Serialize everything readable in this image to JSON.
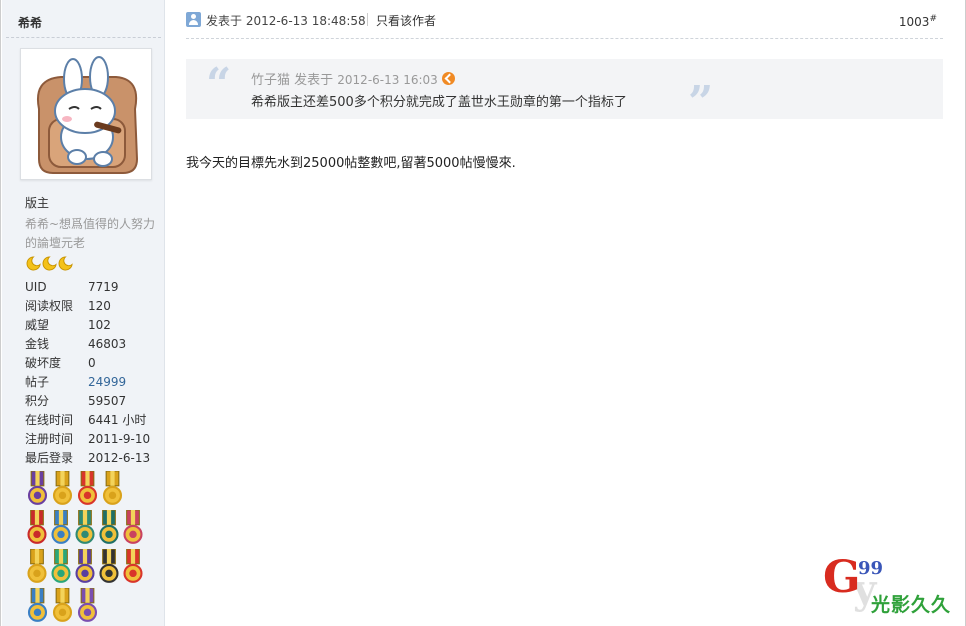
{
  "user": {
    "name": "希希",
    "role": "版主",
    "signature": "希希~想爲值得的人努力的論壇元老",
    "stats": [
      {
        "key": "UID",
        "value": "7719",
        "link": false
      },
      {
        "key": "阅读权限",
        "value": "120",
        "link": false
      },
      {
        "key": "威望",
        "value": "102",
        "link": false
      },
      {
        "key": "金钱",
        "value": "46803",
        "link": false
      },
      {
        "key": "破坏度",
        "value": "0",
        "link": false
      },
      {
        "key": "帖子",
        "value": "24999",
        "link": true
      },
      {
        "key": "积分",
        "value": "59507",
        "link": false
      },
      {
        "key": "在线时间",
        "value": "6441 小时",
        "link": false
      },
      {
        "key": "注册时间",
        "value": "2011-9-10",
        "link": false
      },
      {
        "key": "最后登录",
        "value": "2012-6-13",
        "link": false
      }
    ],
    "avatar_icon": "cartoon-rabbit-in-armchair",
    "star_icon": "crescent-moon-icon",
    "star_count": 3
  },
  "post": {
    "time": "发表于 2012-6-13 18:48:58",
    "only_author": "只看该作者",
    "floor": "1003",
    "floor_mark": "#",
    "quote": {
      "author": "竹子猫 发表于",
      "time": "2012-6-13 16:03",
      "text": "希希版主还差500多个积分就完成了盖世水王勋章的第一个指标了"
    },
    "content": "我今天的目標先水到25000帖整數吧,留著5000帖慢慢來."
  },
  "medals": [
    [
      "#6a3fa0",
      "#d9a21b",
      "#d9352a",
      "#d9a21b"
    ],
    [
      "#c92a2a",
      "#3a7fc4",
      "#2f8a74",
      "#1f6f66",
      "#c9425f"
    ],
    [
      "#d9a21b",
      "#2aa67a",
      "#5a3fa0",
      "#333333",
      "#d9352a"
    ],
    [
      "#3a7fc4",
      "#d9a21b",
      "#7a4fb0"
    ]
  ],
  "logo": {
    "g": "G",
    "nine": "99",
    "y": "y",
    "cn": "光影久久"
  }
}
